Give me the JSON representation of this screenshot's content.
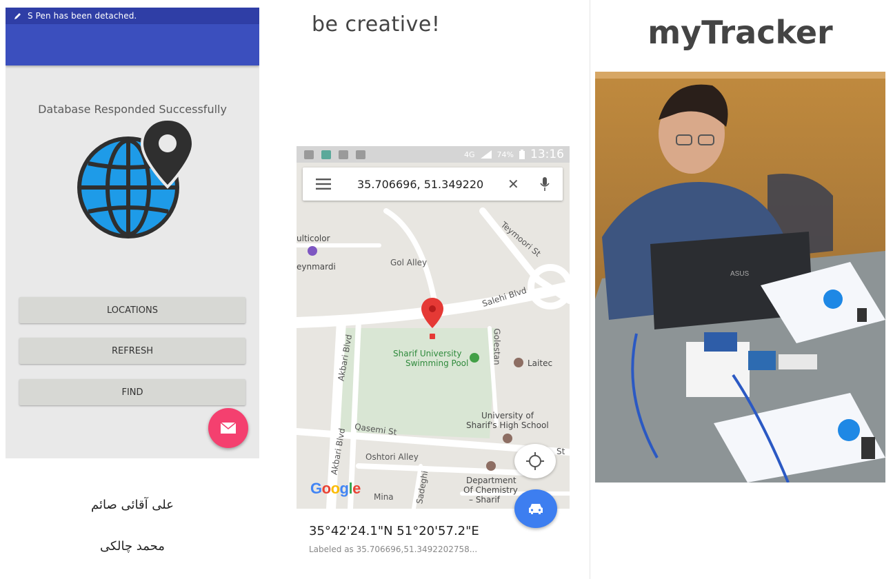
{
  "left_phone": {
    "status_text": "S Pen has been detached.",
    "message": "Database Responded Successfully",
    "buttons": {
      "locations": "LOCATIONS",
      "refresh": "REFRESH",
      "find": "FIND"
    }
  },
  "names": {
    "first": "علی آقائی صائم",
    "second": "محمد چالکی"
  },
  "tagline": "be creative!",
  "map_phone": {
    "status": {
      "network": "4G",
      "battery": "74%",
      "time": "13:16"
    },
    "search_query": "35.706696, 51.349220",
    "labels": {
      "multicolor": "ulticolor",
      "eynmardi": "eynmardi",
      "gol_alley": "Gol Alley",
      "teymoori": "Teymoori St",
      "salehi": "Salehi Blvd",
      "sharif_pool_1": "Sharif University",
      "sharif_pool_2": "Swimming Pool",
      "golestan": "Golestan",
      "laitec": "Laitec",
      "akbari_top": "Akbari Blvd",
      "akbari_bottom": "Akbari Blvd",
      "qasemi": "Qasemi St",
      "oshtori": "Oshtori Alley",
      "univ_chem_1": "University of",
      "univ_chem_2": "Sharif's High School",
      "dept_1": "Department",
      "dept_2": "Of Chemistry",
      "dept_3": "– Sharif",
      "mina": "Mina",
      "sadeghi": "Sadeghi",
      "st_suffix": "St",
      "google": "Google"
    },
    "coord_title": "35°42'24.1\"N 51°20'57.2\"E",
    "coord_subtitle": "Labeled as 35.706696,51.3492202758..."
  },
  "app_title": "myTracker",
  "colors": {
    "status_bar": "#2f3ea6",
    "app_bar": "#3b4fbe",
    "fab_pink": "#f4406f",
    "globe_blue": "#1e9be8",
    "pin_dark": "#2f2f2f",
    "map_pin": "#e53935",
    "fab_blue": "#3d7ef0"
  }
}
